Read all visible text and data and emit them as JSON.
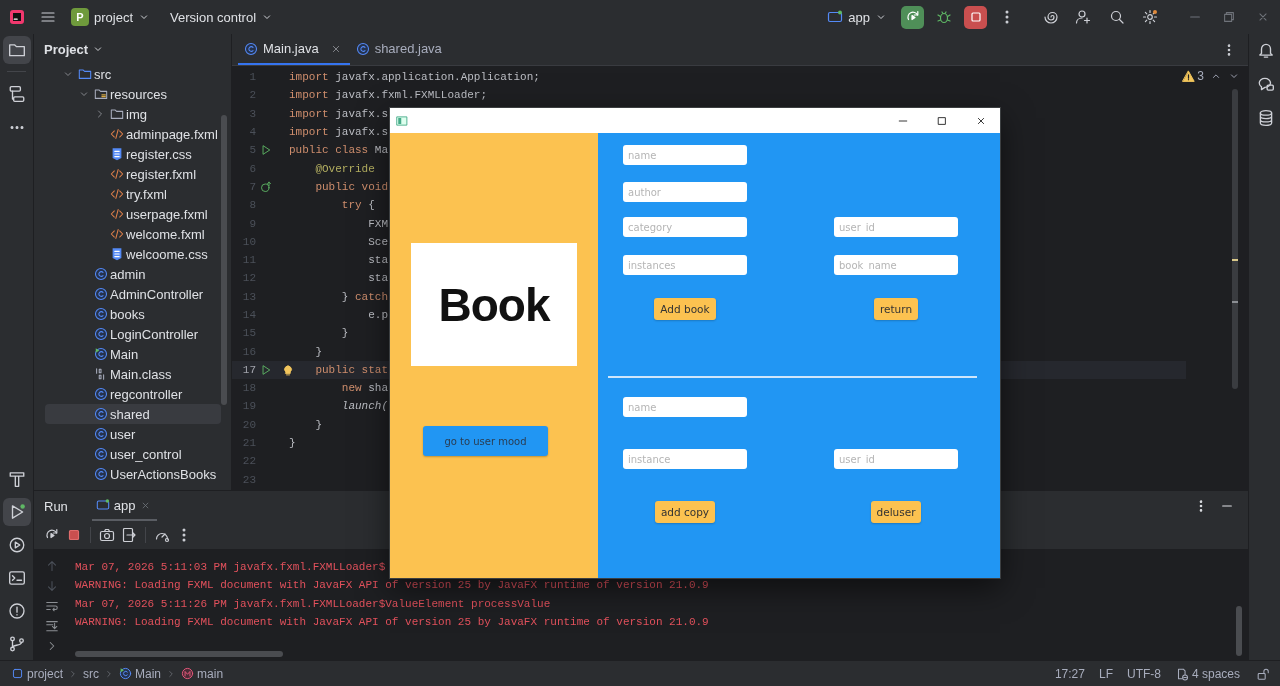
{
  "ide_title_bar": {
    "project_badge": "P",
    "project": "project",
    "vcs": "Version control",
    "run_config": "app"
  },
  "left_toolbar": {
    "top": [
      {
        "kind": "project",
        "selected": true
      },
      {
        "kind": "structure",
        "selected": false
      },
      {
        "kind": "more",
        "selected": false
      }
    ],
    "bottom": [
      {
        "kind": "build",
        "selected": false
      },
      {
        "kind": "run",
        "selected": true
      },
      {
        "kind": "services",
        "selected": false
      },
      {
        "kind": "terminal",
        "selected": false
      },
      {
        "kind": "problems",
        "selected": false
      },
      {
        "kind": "git",
        "selected": false
      }
    ]
  },
  "right_toolbar": [
    {
      "kind": "notifications"
    },
    {
      "kind": "ai-chat"
    },
    {
      "kind": "database"
    }
  ],
  "project_panel": {
    "title": "Project",
    "tree": [
      {
        "name": "src",
        "kind": "source-folder",
        "expanded": true,
        "selected": false,
        "children": [
          {
            "name": "resources",
            "kind": "resource-folder",
            "expanded": true,
            "selected": false,
            "children": [
              {
                "name": "img",
                "kind": "folder",
                "expanded": false,
                "selected": false
              },
              {
                "name": "adminpage.fxml",
                "kind": "fxml",
                "selected": false
              },
              {
                "name": "register.css",
                "kind": "css",
                "selected": false
              },
              {
                "name": "register.fxml",
                "kind": "fxml",
                "selected": false
              },
              {
                "name": "try.fxml",
                "kind": "fxml",
                "selected": false
              },
              {
                "name": "userpage.fxml",
                "kind": "fxml",
                "selected": false
              },
              {
                "name": "welcome.fxml",
                "kind": "fxml",
                "selected": false
              },
              {
                "name": "welcoome.css",
                "kind": "css",
                "selected": false
              }
            ]
          },
          {
            "name": "admin",
            "kind": "class",
            "selected": false
          },
          {
            "name": "AdminController",
            "kind": "class",
            "selected": false
          },
          {
            "name": "books",
            "kind": "class",
            "selected": false
          },
          {
            "name": "LoginController",
            "kind": "class",
            "selected": false
          },
          {
            "name": "Main",
            "kind": "main-class",
            "selected": false
          },
          {
            "name": "Main.class",
            "kind": "binary",
            "selected": false
          },
          {
            "name": "regcontroller",
            "kind": "class",
            "selected": false
          },
          {
            "name": "shared",
            "kind": "class",
            "selected": true
          },
          {
            "name": "user",
            "kind": "class",
            "selected": false
          },
          {
            "name": "user_control",
            "kind": "class",
            "selected": false
          },
          {
            "name": "UserActionsBooks",
            "kind": "class",
            "selected": false
          }
        ]
      }
    ]
  },
  "editor": {
    "tabs": [
      {
        "label": "Main.java",
        "selected": true
      },
      {
        "label": "shared.java",
        "selected": false
      }
    ],
    "warnings_count": "3",
    "lines": [
      {
        "number": "1",
        "current": false,
        "tokens": [
          {
            "kind": "keyword",
            "text": "import"
          },
          {
            "kind": "plain",
            "text": " javafx.application.Application;"
          }
        ]
      },
      {
        "number": "2",
        "current": false,
        "tokens": [
          {
            "kind": "keyword",
            "text": "import"
          },
          {
            "kind": "plain",
            "text": " javafx.fxml.FXMLLoader;"
          }
        ]
      },
      {
        "number": "3",
        "current": false,
        "tokens": [
          {
            "kind": "keyword",
            "text": "import"
          },
          {
            "kind": "plain",
            "text": " javafx.s"
          }
        ]
      },
      {
        "number": "4",
        "current": false,
        "tokens": [
          {
            "kind": "keyword",
            "text": "import"
          },
          {
            "kind": "plain",
            "text": " javafx.s"
          }
        ]
      },
      {
        "number": "5",
        "current": false,
        "gutter_icon": {
          "kind": "run"
        },
        "tokens": [
          {
            "kind": "keyword",
            "text": "public class"
          },
          {
            "kind": "plain",
            "text": " Ma"
          }
        ]
      },
      {
        "number": "6",
        "current": false,
        "tokens": [
          {
            "kind": "annotation",
            "text": "    @Override"
          }
        ]
      },
      {
        "number": "7",
        "current": false,
        "gutter_icon": {
          "kind": "override"
        },
        "tokens": [
          {
            "kind": "keyword",
            "text": "    public void"
          }
        ]
      },
      {
        "number": "8",
        "current": false,
        "tokens": [
          {
            "kind": "keyword",
            "text": "        try"
          },
          {
            "kind": "plain",
            "text": " {"
          }
        ]
      },
      {
        "number": "9",
        "current": false,
        "tokens": [
          {
            "kind": "plain",
            "text": "            FXM"
          }
        ]
      },
      {
        "number": "10",
        "current": false,
        "tokens": [
          {
            "kind": "plain",
            "text": "            Sce"
          }
        ]
      },
      {
        "number": "11",
        "current": false,
        "tokens": [
          {
            "kind": "plain",
            "text": "            sta"
          }
        ]
      },
      {
        "number": "12",
        "current": false,
        "tokens": [
          {
            "kind": "plain",
            "text": "            sta"
          }
        ]
      },
      {
        "number": "13",
        "current": false,
        "tokens": [
          {
            "kind": "plain",
            "text": "        } "
          },
          {
            "kind": "keyword",
            "text": "catch"
          }
        ]
      },
      {
        "number": "14",
        "current": false,
        "tokens": [
          {
            "kind": "plain",
            "text": "            e.p"
          }
        ]
      },
      {
        "number": "15",
        "current": false,
        "tokens": [
          {
            "kind": "plain",
            "text": "        }"
          }
        ]
      },
      {
        "number": "16",
        "current": false,
        "tokens": [
          {
            "kind": "plain",
            "text": "    }"
          }
        ]
      },
      {
        "number": "17",
        "current": true,
        "gutter_icon": {
          "kind": "run"
        },
        "hint": {
          "kind": "bulb"
        },
        "tokens": [
          {
            "kind": "keyword",
            "text": "    public stat"
          }
        ]
      },
      {
        "number": "18",
        "current": false,
        "tokens": [
          {
            "kind": "keyword",
            "text": "        new"
          },
          {
            "kind": "plain",
            "text": " sha"
          }
        ]
      },
      {
        "number": "19",
        "current": false,
        "tokens": [
          {
            "kind": "italic",
            "text": "        launch("
          }
        ]
      },
      {
        "number": "20",
        "current": false,
        "tokens": [
          {
            "kind": "plain",
            "text": "    }"
          }
        ]
      },
      {
        "number": "21",
        "current": false,
        "tokens": [
          {
            "kind": "plain",
            "text": "}"
          }
        ]
      },
      {
        "number": "22",
        "current": false
      },
      {
        "number": "23",
        "current": false
      }
    ]
  },
  "run_panel": {
    "title": "Run",
    "tabs": [
      {
        "label": "app",
        "selected": true
      }
    ],
    "console": [
      "Mar 07, 2026 5:11:03 PM javafx.fxml.FXMLLoader$",
      "WARNING: Loading FXML document with JavaFX API of version 25 by JavaFX runtime of version 21.0.9",
      "Mar 07, 2026 5:11:26 PM javafx.fxml.FXMLLoader$ValueElement processValue",
      "WARNING: Loading FXML document with JavaFX API of version 25 by JavaFX runtime of version 21.0.9"
    ]
  },
  "status_bar": {
    "breadcrumbs": [
      {
        "label": "project",
        "kind": "project"
      },
      {
        "label": "src",
        "kind": "folder"
      },
      {
        "label": "Main",
        "kind": "class"
      },
      {
        "label": "main",
        "kind": "method"
      }
    ],
    "caret": "17:27",
    "line_ending": "LF",
    "encoding": "UTF-8",
    "indent": "4 spaces"
  },
  "app_window": {
    "logo_text": "Book",
    "side_button": "go to user mood",
    "sections": [
      {
        "rows": [
          {
            "left": {
              "kind": "field",
              "placeholder": "name"
            }
          },
          {
            "left": {
              "kind": "field",
              "placeholder": "author"
            }
          },
          {
            "left": {
              "kind": "field",
              "placeholder": "category"
            },
            "right": {
              "kind": "field",
              "placeholder": "user_id"
            }
          },
          {
            "left": {
              "kind": "field",
              "placeholder": "instances"
            },
            "right": {
              "kind": "field",
              "placeholder": "book_name"
            }
          },
          {
            "left": {
              "kind": "button",
              "label": "Add book"
            },
            "right": {
              "kind": "button",
              "label": "return"
            }
          }
        ]
      },
      {
        "rows": [
          {
            "left": {
              "kind": "field",
              "placeholder": "name"
            }
          },
          {
            "left": {
              "kind": "field",
              "placeholder": "instance"
            },
            "right": {
              "kind": "field",
              "placeholder": "user_id"
            }
          },
          {
            "left": {
              "kind": "button",
              "label": "add copy"
            },
            "right": {
              "kind": "button",
              "label": "deluser"
            }
          }
        ]
      }
    ]
  }
}
